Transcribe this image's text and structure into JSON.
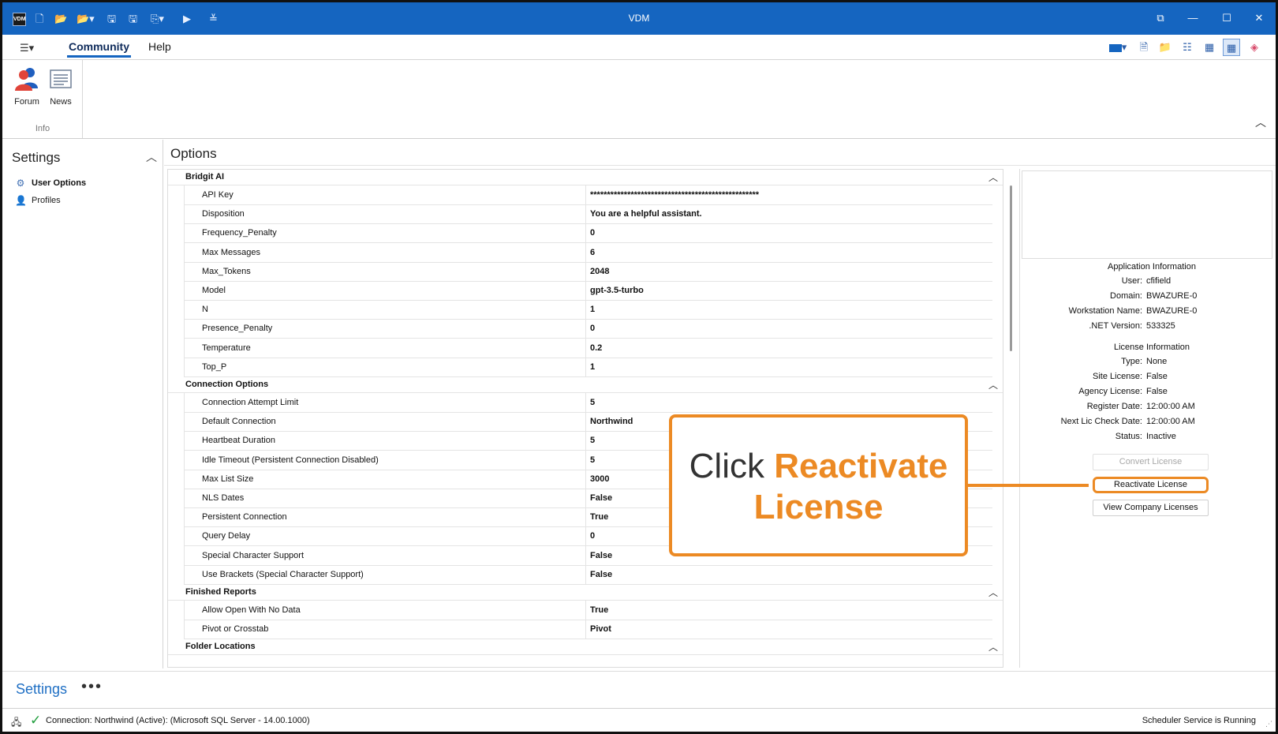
{
  "window": {
    "title": "VDM",
    "app_icon_text": "VDM",
    "quick_access": [
      "new-file-icon",
      "open-folder-icon",
      "open-folder-dropdown-icon",
      "save-icon",
      "save-all-icon",
      "export-dropdown-icon",
      "run-icon",
      "customize-dropdown-icon"
    ],
    "controls": [
      "restore-layout-icon",
      "minimize-icon",
      "maximize-icon",
      "close-icon"
    ]
  },
  "ribbon": {
    "tabs": [
      {
        "label": "Community",
        "active": true
      },
      {
        "label": "Help",
        "active": false
      }
    ],
    "groups": [
      {
        "label": "Info",
        "buttons": [
          {
            "label": "Forum",
            "icon": "forum-users-icon"
          },
          {
            "label": "News",
            "icon": "news-icon"
          }
        ]
      }
    ],
    "right_tools": [
      "theme-color-icon",
      "new-document-icon",
      "folder-icon",
      "list-view-icon",
      "grid-view-icon",
      "tile-view-icon",
      "eraser-icon"
    ]
  },
  "settings_pane": {
    "title": "Settings",
    "items": [
      {
        "label": "User Options",
        "icon": "user-options-icon",
        "active": true
      },
      {
        "label": "Profiles",
        "icon": "person-icon",
        "active": false
      }
    ]
  },
  "options": {
    "title": "Options",
    "categories": [
      {
        "name": "Bridgit AI",
        "rows": [
          {
            "key": "API Key",
            "value": "**************************************************"
          },
          {
            "key": "Disposition",
            "value": "You are a helpful assistant."
          },
          {
            "key": "Frequency_Penalty",
            "value": "0"
          },
          {
            "key": "Max Messages",
            "value": "6"
          },
          {
            "key": "Max_Tokens",
            "value": "2048"
          },
          {
            "key": "Model",
            "value": "gpt-3.5-turbo"
          },
          {
            "key": "N",
            "value": "1"
          },
          {
            "key": "Presence_Penalty",
            "value": "0"
          },
          {
            "key": "Temperature",
            "value": "0.2"
          },
          {
            "key": "Top_P",
            "value": "1"
          }
        ]
      },
      {
        "name": "Connection Options",
        "rows": [
          {
            "key": "Connection Attempt Limit",
            "value": "5"
          },
          {
            "key": "Default Connection",
            "value": "Northwind"
          },
          {
            "key": "Heartbeat Duration",
            "value": "5"
          },
          {
            "key": "Idle Timeout (Persistent Connection Disabled)",
            "value": "5"
          },
          {
            "key": "Max List Size",
            "value": "3000"
          },
          {
            "key": "NLS Dates",
            "value": "False"
          },
          {
            "key": "Persistent Connection",
            "value": "True"
          },
          {
            "key": "Query Delay",
            "value": "0"
          },
          {
            "key": "Special Character Support",
            "value": "False"
          },
          {
            "key": "Use Brackets (Special Character Support)",
            "value": "False"
          }
        ]
      },
      {
        "name": "Finished Reports",
        "rows": [
          {
            "key": "Allow Open With No Data",
            "value": "True"
          },
          {
            "key": "Pivot or Crosstab",
            "value": "Pivot"
          }
        ]
      },
      {
        "name": "Folder Locations",
        "rows": []
      }
    ]
  },
  "info_panel": {
    "application_title": "Application Information",
    "application": [
      {
        "label": "User:",
        "value": "cfifield"
      },
      {
        "label": "Domain:",
        "value": "BWAZURE-0"
      },
      {
        "label": "Workstation Name:",
        "value": "BWAZURE-0"
      },
      {
        "label": ".NET Version:",
        "value": "533325"
      }
    ],
    "license_title": "License Information",
    "license": [
      {
        "label": "Type:",
        "value": "None"
      },
      {
        "label": "Site License:",
        "value": "False"
      },
      {
        "label": "Agency License:",
        "value": "False"
      },
      {
        "label": "Register Date:",
        "value": "12:00:00 AM"
      },
      {
        "label": "Next Lic Check Date:",
        "value": "12:00:00 AM"
      },
      {
        "label": "Status:",
        "value": "Inactive"
      }
    ],
    "buttons": {
      "convert": "Convert License",
      "reactivate": "Reactivate License",
      "view_company": "View Company Licenses"
    }
  },
  "callout": {
    "prefix": "Click",
    "emphasis_line1": "Reactivate",
    "emphasis_line2": "License",
    "color": "#ec8a24"
  },
  "bottom_bar": {
    "label": "Settings",
    "more": "•••"
  },
  "status_bar": {
    "connection": "Connection: Northwind (Active): (Microsoft SQL Server - 14.00.1000)",
    "scheduler": "Scheduler Service is Running"
  },
  "colors": {
    "titlebar": "#1565c0",
    "accent_orange": "#ec8a24",
    "status_ok": "#1e9d3b",
    "link_blue": "#1f6fc4"
  }
}
